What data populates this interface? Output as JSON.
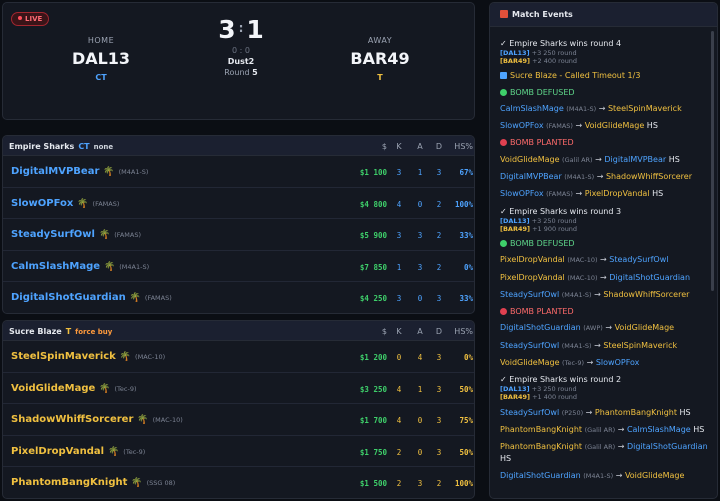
{
  "score": {
    "live": "LIVE",
    "home_label": "HOME",
    "home_team": "DAL13",
    "home_side": "CT",
    "away_label": "AWAY",
    "away_team": "BAR49",
    "away_side": "T",
    "home_score": "3",
    "away_score": "1",
    "separator": ":",
    "small_score": "0 : 0",
    "map": "Dust2",
    "round_label": "Round",
    "round_num": "5"
  },
  "columns": {
    "money": "$",
    "k": "K",
    "a": "A",
    "d": "D",
    "hs": "HS%"
  },
  "team1": {
    "name": "Empire Sharks",
    "side": "CT",
    "econ": "none",
    "players": [
      {
        "name": "DigitalMVPBear",
        "weapon": "(M4A1-S)",
        "money": "$1 100",
        "k": "3",
        "a": "1",
        "d": "3",
        "hs": "67%"
      },
      {
        "name": "SlowOPFox",
        "weapon": "(FAMAS)",
        "money": "$4 800",
        "k": "4",
        "a": "0",
        "d": "2",
        "hs": "100%"
      },
      {
        "name": "SteadySurfOwl",
        "weapon": "(FAMAS)",
        "money": "$5 900",
        "k": "3",
        "a": "3",
        "d": "2",
        "hs": "33%"
      },
      {
        "name": "CalmSlashMage",
        "weapon": "(M4A1-S)",
        "money": "$7 850",
        "k": "1",
        "a": "3",
        "d": "2",
        "hs": "0%"
      },
      {
        "name": "DigitalShotGuardian",
        "weapon": "(FAMAS)",
        "money": "$4 250",
        "k": "3",
        "a": "0",
        "d": "3",
        "hs": "33%"
      }
    ]
  },
  "team2": {
    "name": "Sucre Blaze",
    "side": "T",
    "econ": "force buy",
    "players": [
      {
        "name": "SteelSpinMaverick",
        "weapon": "(MAC-10)",
        "money": "$1 200",
        "k": "0",
        "a": "4",
        "d": "3",
        "hs": "0%"
      },
      {
        "name": "VoidGlideMage",
        "weapon": "(Tec-9)",
        "money": "$3 250",
        "k": "4",
        "a": "1",
        "d": "3",
        "hs": "50%"
      },
      {
        "name": "ShadowWhiffSorcerer",
        "weapon": "(MAC-10)",
        "money": "$1 700",
        "k": "4",
        "a": "0",
        "d": "3",
        "hs": "75%"
      },
      {
        "name": "PixelDropVandal",
        "weapon": "(Tec-9)",
        "money": "$1 750",
        "k": "2",
        "a": "0",
        "d": "3",
        "hs": "50%"
      },
      {
        "name": "PhantomBangKnight",
        "weapon": "(SSG 08)",
        "money": "$1 500",
        "k": "2",
        "a": "3",
        "d": "2",
        "hs": "100%"
      }
    ]
  },
  "events": {
    "title": "Match Events",
    "arrow": "→",
    "hs": "HS",
    "round4": {
      "text": "✓ Empire Sharks wins round 4",
      "t1": "[DAL13]",
      "t1v": "+3 250 round",
      "t2": "[BAR49]",
      "t2v": "+2 400 round"
    },
    "timeout": "Sucre Blaze - Called Timeout 1/3",
    "defused": "BOMB DEFUSED",
    "planted": "BOMB PLANTED",
    "k1": {
      "a": "CalmSlashMage",
      "w": "(M4A1-S)",
      "v": "SteelSpinMaverick"
    },
    "k2": {
      "a": "SlowOPFox",
      "w": "(FAMAS)",
      "v": "VoidGlideMage"
    },
    "k3": {
      "a": "VoidGlideMage",
      "w": "(Galil AR)",
      "v": "DigitalMVPBear"
    },
    "k4": {
      "a": "DigitalMVPBear",
      "w": "(M4A1-S)",
      "v": "ShadowWhiffSorcerer"
    },
    "k5": {
      "a": "SlowOPFox",
      "w": "(FAMAS)",
      "v": "PixelDropVandal"
    },
    "round3": {
      "text": "✓ Empire Sharks wins round 3",
      "t1": "[DAL13]",
      "t1v": "+3 250 round",
      "t2": "[BAR49]",
      "t2v": "+1 900 round"
    },
    "k6": {
      "a": "PixelDropVandal",
      "w": "(MAC-10)",
      "v": "SteadySurfOwl"
    },
    "k7": {
      "a": "PixelDropVandal",
      "w": "(MAC-10)",
      "v": "DigitalShotGuardian"
    },
    "k8": {
      "a": "SteadySurfOwl",
      "w": "(M4A1-S)",
      "v": "ShadowWhiffSorcerer"
    },
    "k9": {
      "a": "DigitalShotGuardian",
      "w": "(AWP)",
      "v": "VoidGlideMage"
    },
    "k10": {
      "a": "SteadySurfOwl",
      "w": "(M4A1-S)",
      "v": "SteelSpinMaverick"
    },
    "k11": {
      "a": "VoidGlideMage",
      "w": "(Tec-9)",
      "v": "SlowOPFox"
    },
    "round2": {
      "text": "✓ Empire Sharks wins round 2",
      "t1": "[DAL13]",
      "t1v": "+3 250 round",
      "t2": "[BAR49]",
      "t2v": "+1 400 round"
    },
    "k12": {
      "a": "SteadySurfOwl",
      "w": "(P250)",
      "v": "PhantomBangKnight"
    },
    "k13": {
      "a": "PhantomBangKnight",
      "w": "(Galil AR)",
      "v": "CalmSlashMage"
    },
    "k14": {
      "a": "PhantomBangKnight",
      "w": "(Galil AR)",
      "v": "DigitalShotGuardian"
    },
    "k15": {
      "a": "DigitalShotGuardian",
      "w": "(M4A1-S)",
      "v": "VoidGlideMage"
    }
  }
}
